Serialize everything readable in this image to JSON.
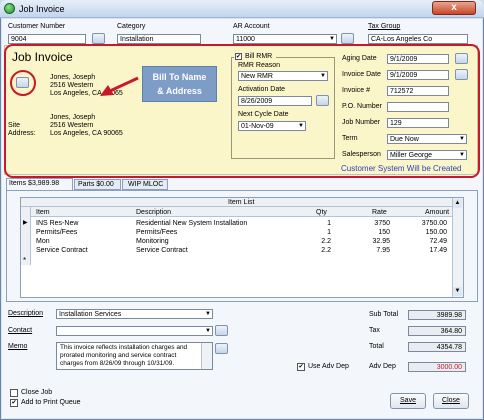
{
  "window": {
    "title": "Job Invoice",
    "close_label": "x"
  },
  "header": {
    "customer_number_label": "Customer Number",
    "customer_number": "9004",
    "category_label": "Category",
    "category": "Installation",
    "ar_account_label": "AR Account",
    "ar_account": "11000",
    "tax_group_label": "Tax Group",
    "tax_group": "CA-Los Angeles Co"
  },
  "invoice": {
    "heading": "Job Invoice",
    "bill_to": [
      "Jones, Joseph",
      "2516 Western",
      "Los Angeles, CA  90065"
    ],
    "site_label": "Site",
    "site_address_label": "Address:",
    "site": [
      "Jones, Joseph",
      "2516 Western",
      "Los Angeles, CA  90065"
    ],
    "callout": "Bill To Name\n& Address"
  },
  "rmr": {
    "bill_rmr_label": "Bill RMR",
    "reason_label": "RMR Reason",
    "reason": "New RMR",
    "activation_label": "Activation Date",
    "activation": "8/26/2009",
    "next_cycle_label": "Next Cycle Date",
    "next_cycle": "01-Nov-09"
  },
  "details": {
    "aging_label": "Aging Date",
    "aging": "9/1/2009",
    "invoice_date_label": "Invoice Date",
    "invoice_date": "9/1/2009",
    "invoice_no_label": "Invoice #",
    "invoice_no": "712572",
    "po_label": "P.O. Number",
    "po": "",
    "job_label": "Job Number",
    "job": "129",
    "term_label": "Term",
    "term": "Due Now",
    "salesperson_label": "Salesperson",
    "salesperson": "Miller George",
    "status": "Customer System Will be Created"
  },
  "tabs": [
    {
      "label": "Items $3,989.98"
    },
    {
      "label": "Parts $0.00"
    },
    {
      "label": "WIP MLOC"
    }
  ],
  "grid": {
    "title": "Item List",
    "columns": [
      "Item",
      "Description",
      "Qty",
      "Rate",
      "Amount"
    ],
    "rows": [
      [
        "INS Res-New",
        "Residential New System Installation",
        "1",
        "3750",
        "3750.00"
      ],
      [
        "Permits/Fees",
        "Permits/Fees",
        "1",
        "150",
        "150.00"
      ],
      [
        "Mon",
        "Monitoring",
        "2.2",
        "32.95",
        "72.49"
      ],
      [
        "Service Contract",
        "Service Contract",
        "2.2",
        "7.95",
        "17.49"
      ]
    ],
    "new_row_marker": "*",
    "current_row_marker": "▶"
  },
  "footer": {
    "description_label": "Description",
    "description": "Installation Services",
    "contact_label": "Contact",
    "contact": "",
    "memo_label": "Memo",
    "memo": "This invoice reflects installation charges and prorated monitoring and service contract charges from 8/26/09 through 10/31/09.",
    "use_adv_dep_label": "Use Adv Dep",
    "subtotal_label": "Sub Total",
    "subtotal": "3989.98",
    "tax_label": "Tax",
    "tax": "364.80",
    "total_label": "Total",
    "total": "4354.78",
    "adv_dep_label": "Adv Dep",
    "adv_dep": "3000.00",
    "close_job_label": "Close Job",
    "print_queue_label": "Add to Print Queue",
    "save_label": "Save",
    "close_label": "Close"
  },
  "colors": {
    "highlight_border": "#c8182a",
    "arrow": "#c8182a",
    "callout_bg": "#7d9cc6",
    "status_text": "#2b3fbf",
    "adv_dep_text": "#c8182a"
  }
}
